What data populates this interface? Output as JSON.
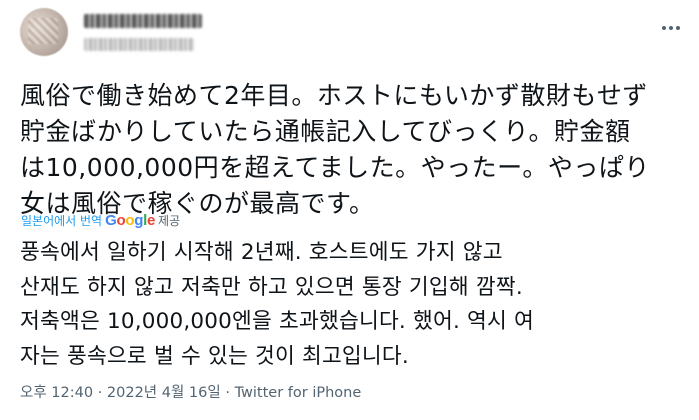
{
  "tweet": {
    "original_lines": [
      "風俗で働き始めて2年目。ホストにもいかず散財もせず",
      "貯金ばかりしていたら通帳記入してびっくり。貯金額",
      "は10,000,000円を超えてました。やったー。やっぱり",
      "女は風俗で稼ぐのが最高です。"
    ],
    "translate": {
      "label": "일본어에서 번역",
      "google": [
        "G",
        "o",
        "o",
        "g",
        "l",
        "e"
      ],
      "provided": "제공"
    },
    "translated_lines": [
      "풍속에서 일하기 시작해 2년째. 호스트에도 가지 않고",
      "산재도 하지 않고 저축만 하고 있으면 통장 기입해 깜짝.",
      "저축액은 10,000,000엔을 초과했습니다. 했어. 역시 여",
      "자는 풍속으로 벌 수 있는 것이 최고입니다."
    ],
    "meta": {
      "time": "오후 12:40",
      "separator": " · ",
      "date": "2022년 4월 16일",
      "source": "Twitter for iPhone"
    }
  },
  "colors": {
    "text": "#0f1419",
    "secondary": "#536471",
    "link": "#1d9bf0"
  }
}
